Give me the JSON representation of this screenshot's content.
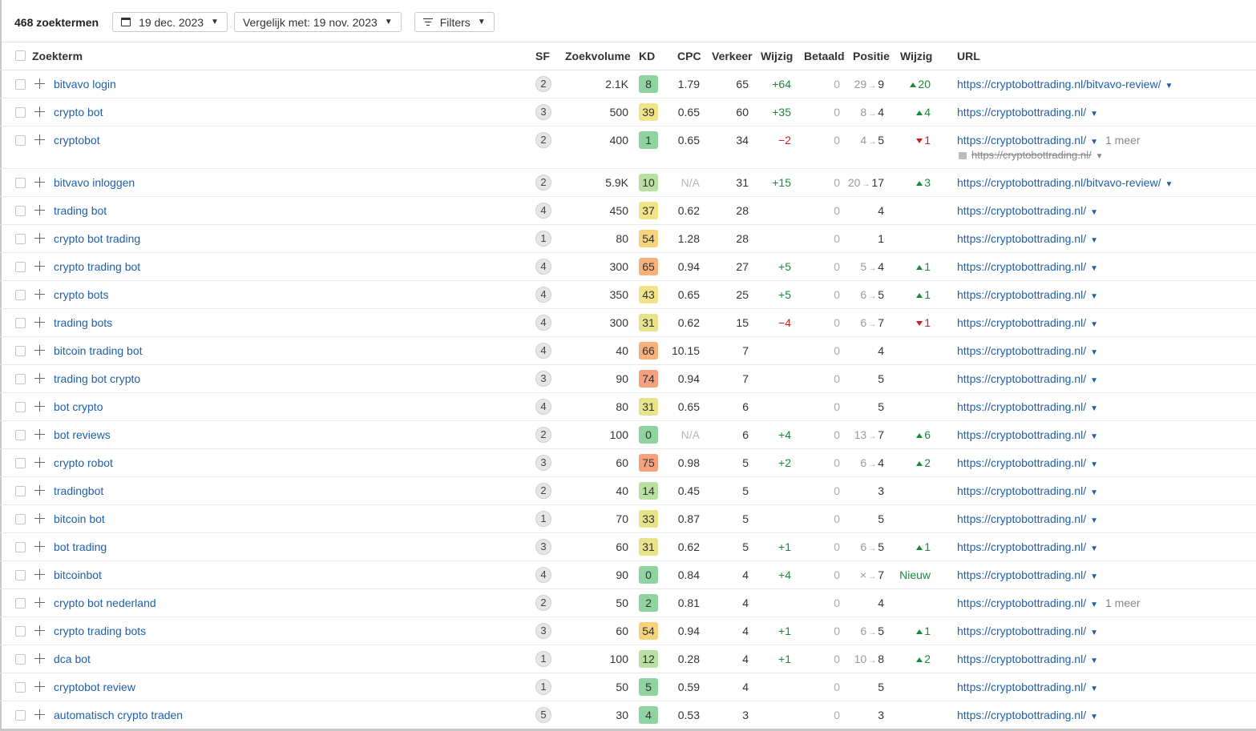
{
  "toolbar": {
    "count_label": "468 zoektermen",
    "date_label": "19 dec. 2023",
    "compare_label": "Vergelijk met: 19 nov. 2023",
    "filters_label": "Filters"
  },
  "columns": {
    "zoekterm": "Zoekterm",
    "sf": "SF",
    "zoekvolume": "Zoekvolume",
    "kd": "KD",
    "cpc": "CPC",
    "verkeer": "Verkeer",
    "wijzig": "Wijzig",
    "betaald": "Betaald",
    "positie": "Positie",
    "wijzig2": "Wijzig",
    "url": "URL"
  },
  "kd_colors": {
    "very_easy": "#8fd4a0",
    "easy": "#b7e0a2",
    "medium": "#f1e387",
    "hard": "#f7d37a",
    "very_hard": "#f7b07a",
    "super_hard": "#f6a07e"
  },
  "rows": [
    {
      "keyword": "bitvavo login",
      "sf": "2",
      "volume": "2.1K",
      "kd": "8",
      "kd_color": "#8fd4a0",
      "cpc": "1.79",
      "traffic": "65",
      "traffic_change": "+64",
      "paid": "0",
      "pos_prev": "29",
      "pos": "9",
      "pos_change": "20",
      "pos_dir": "up",
      "url": "https://cryptobottrading.nl/bitvavo-review/"
    },
    {
      "keyword": "crypto bot",
      "sf": "3",
      "volume": "500",
      "kd": "39",
      "kd_color": "#f1e387",
      "cpc": "0.65",
      "traffic": "60",
      "traffic_change": "+35",
      "paid": "0",
      "pos_prev": "8",
      "pos": "4",
      "pos_change": "4",
      "pos_dir": "up",
      "url": "https://cryptobottrading.nl/"
    },
    {
      "keyword": "cryptobot",
      "sf": "2",
      "volume": "400",
      "kd": "1",
      "kd_color": "#8fd4a0",
      "cpc": "0.65",
      "traffic": "34",
      "traffic_change": "−2",
      "paid": "0",
      "pos_prev": "4",
      "pos": "5",
      "pos_change": "1",
      "pos_dir": "down",
      "url": "https://cryptobottrading.nl/",
      "more": "1 meer",
      "old_url": "https://cryptobottrading.nl/"
    },
    {
      "keyword": "bitvavo inloggen",
      "sf": "2",
      "volume": "5.9K",
      "kd": "10",
      "kd_color": "#b7e0a2",
      "cpc": "N/A",
      "traffic": "31",
      "traffic_change": "+15",
      "paid": "0",
      "pos_prev": "20",
      "pos": "17",
      "pos_change": "3",
      "pos_dir": "up",
      "url": "https://cryptobottrading.nl/bitvavo-review/"
    },
    {
      "keyword": "trading bot",
      "sf": "4",
      "volume": "450",
      "kd": "37",
      "kd_color": "#f1e387",
      "cpc": "0.62",
      "traffic": "28",
      "traffic_change": "",
      "paid": "0",
      "pos_prev": "",
      "pos": "4",
      "pos_change": "",
      "pos_dir": "",
      "url": "https://cryptobottrading.nl/"
    },
    {
      "keyword": "crypto bot trading",
      "sf": "1",
      "volume": "80",
      "kd": "54",
      "kd_color": "#f7d37a",
      "cpc": "1.28",
      "traffic": "28",
      "traffic_change": "",
      "paid": "0",
      "pos_prev": "",
      "pos": "1",
      "pos_change": "",
      "pos_dir": "",
      "url": "https://cryptobottrading.nl/"
    },
    {
      "keyword": "crypto trading bot",
      "sf": "4",
      "volume": "300",
      "kd": "65",
      "kd_color": "#f7b07a",
      "cpc": "0.94",
      "traffic": "27",
      "traffic_change": "+5",
      "paid": "0",
      "pos_prev": "5",
      "pos": "4",
      "pos_change": "1",
      "pos_dir": "up",
      "url": "https://cryptobottrading.nl/"
    },
    {
      "keyword": "crypto bots",
      "sf": "4",
      "volume": "350",
      "kd": "43",
      "kd_color": "#f1e387",
      "cpc": "0.65",
      "traffic": "25",
      "traffic_change": "+5",
      "paid": "0",
      "pos_prev": "6",
      "pos": "5",
      "pos_change": "1",
      "pos_dir": "up",
      "url": "https://cryptobottrading.nl/"
    },
    {
      "keyword": "trading bots",
      "sf": "4",
      "volume": "300",
      "kd": "31",
      "kd_color": "#e6e38a",
      "cpc": "0.62",
      "traffic": "15",
      "traffic_change": "−4",
      "paid": "0",
      "pos_prev": "6",
      "pos": "7",
      "pos_change": "1",
      "pos_dir": "down",
      "url": "https://cryptobottrading.nl/"
    },
    {
      "keyword": "bitcoin trading bot",
      "sf": "4",
      "volume": "40",
      "kd": "66",
      "kd_color": "#f7b07a",
      "cpc": "10.15",
      "traffic": "7",
      "traffic_change": "",
      "paid": "0",
      "pos_prev": "",
      "pos": "4",
      "pos_change": "",
      "pos_dir": "",
      "url": "https://cryptobottrading.nl/"
    },
    {
      "keyword": "trading bot crypto",
      "sf": "3",
      "volume": "90",
      "kd": "74",
      "kd_color": "#f6a07e",
      "cpc": "0.94",
      "traffic": "7",
      "traffic_change": "",
      "paid": "0",
      "pos_prev": "",
      "pos": "5",
      "pos_change": "",
      "pos_dir": "",
      "url": "https://cryptobottrading.nl/"
    },
    {
      "keyword": "bot crypto",
      "sf": "4",
      "volume": "80",
      "kd": "31",
      "kd_color": "#e6e38a",
      "cpc": "0.65",
      "traffic": "6",
      "traffic_change": "",
      "paid": "0",
      "pos_prev": "",
      "pos": "5",
      "pos_change": "",
      "pos_dir": "",
      "url": "https://cryptobottrading.nl/"
    },
    {
      "keyword": "bot reviews",
      "sf": "2",
      "volume": "100",
      "kd": "0",
      "kd_color": "#8fd4a0",
      "cpc": "N/A",
      "traffic": "6",
      "traffic_change": "+4",
      "paid": "0",
      "pos_prev": "13",
      "pos": "7",
      "pos_change": "6",
      "pos_dir": "up",
      "url": "https://cryptobottrading.nl/"
    },
    {
      "keyword": "crypto robot",
      "sf": "3",
      "volume": "60",
      "kd": "75",
      "kd_color": "#f6a07e",
      "cpc": "0.98",
      "traffic": "5",
      "traffic_change": "+2",
      "paid": "0",
      "pos_prev": "6",
      "pos": "4",
      "pos_change": "2",
      "pos_dir": "up",
      "url": "https://cryptobottrading.nl/"
    },
    {
      "keyword": "tradingbot",
      "sf": "2",
      "volume": "40",
      "kd": "14",
      "kd_color": "#b7e0a2",
      "cpc": "0.45",
      "traffic": "5",
      "traffic_change": "",
      "paid": "0",
      "pos_prev": "",
      "pos": "3",
      "pos_change": "",
      "pos_dir": "",
      "url": "https://cryptobottrading.nl/"
    },
    {
      "keyword": "bitcoin bot",
      "sf": "1",
      "volume": "70",
      "kd": "33",
      "kd_color": "#e6e38a",
      "cpc": "0.87",
      "traffic": "5",
      "traffic_change": "",
      "paid": "0",
      "pos_prev": "",
      "pos": "5",
      "pos_change": "",
      "pos_dir": "",
      "url": "https://cryptobottrading.nl/"
    },
    {
      "keyword": "bot trading",
      "sf": "3",
      "volume": "60",
      "kd": "31",
      "kd_color": "#e6e38a",
      "cpc": "0.62",
      "traffic": "5",
      "traffic_change": "+1",
      "paid": "0",
      "pos_prev": "6",
      "pos": "5",
      "pos_change": "1",
      "pos_dir": "up",
      "url": "https://cryptobottrading.nl/"
    },
    {
      "keyword": "bitcoinbot",
      "sf": "4",
      "volume": "90",
      "kd": "0",
      "kd_color": "#8fd4a0",
      "cpc": "0.84",
      "traffic": "4",
      "traffic_change": "+4",
      "paid": "0",
      "pos_prev": "×",
      "pos": "7",
      "pos_change": "Nieuw",
      "pos_dir": "new",
      "url": "https://cryptobottrading.nl/"
    },
    {
      "keyword": "crypto bot nederland",
      "sf": "2",
      "volume": "50",
      "kd": "2",
      "kd_color": "#8fd4a0",
      "cpc": "0.81",
      "traffic": "4",
      "traffic_change": "",
      "paid": "0",
      "pos_prev": "",
      "pos": "4",
      "pos_change": "",
      "pos_dir": "",
      "url": "https://cryptobottrading.nl/",
      "more": "1 meer"
    },
    {
      "keyword": "crypto trading bots",
      "sf": "3",
      "volume": "60",
      "kd": "54",
      "kd_color": "#f7d37a",
      "cpc": "0.94",
      "traffic": "4",
      "traffic_change": "+1",
      "paid": "0",
      "pos_prev": "6",
      "pos": "5",
      "pos_change": "1",
      "pos_dir": "up",
      "url": "https://cryptobottrading.nl/"
    },
    {
      "keyword": "dca bot",
      "sf": "1",
      "volume": "100",
      "kd": "12",
      "kd_color": "#b7e0a2",
      "cpc": "0.28",
      "traffic": "4",
      "traffic_change": "+1",
      "paid": "0",
      "pos_prev": "10",
      "pos": "8",
      "pos_change": "2",
      "pos_dir": "up",
      "url": "https://cryptobottrading.nl/"
    },
    {
      "keyword": "cryptobot review",
      "sf": "1",
      "volume": "50",
      "kd": "5",
      "kd_color": "#8fd4a0",
      "cpc": "0.59",
      "traffic": "4",
      "traffic_change": "",
      "paid": "0",
      "pos_prev": "",
      "pos": "5",
      "pos_change": "",
      "pos_dir": "",
      "url": "https://cryptobottrading.nl/"
    },
    {
      "keyword": "automatisch crypto traden",
      "sf": "5",
      "volume": "30",
      "kd": "4",
      "kd_color": "#8fd4a0",
      "cpc": "0.53",
      "traffic": "3",
      "traffic_change": "",
      "paid": "0",
      "pos_prev": "",
      "pos": "3",
      "pos_change": "",
      "pos_dir": "",
      "url": "https://cryptobottrading.nl/"
    }
  ]
}
